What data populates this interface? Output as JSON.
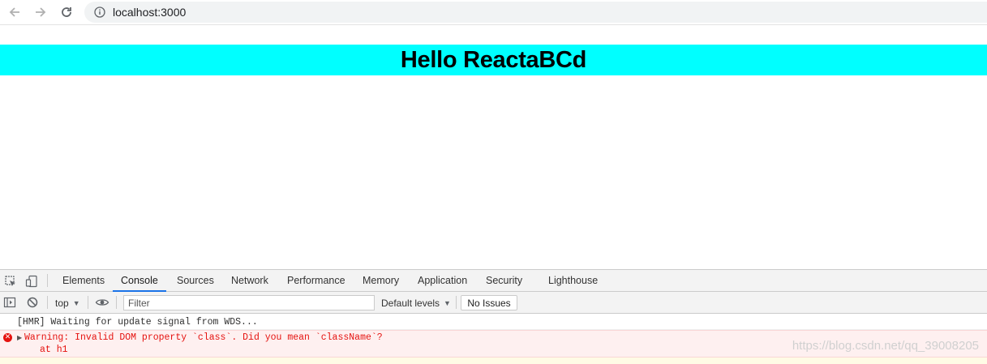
{
  "browser": {
    "url": "localhost:3000"
  },
  "page": {
    "heading": "Hello ReactaBCd",
    "heading_bg": "#00ffff"
  },
  "devtools": {
    "tabs": [
      {
        "label": "Elements"
      },
      {
        "label": "Console",
        "active": true
      },
      {
        "label": "Sources"
      },
      {
        "label": "Network"
      },
      {
        "label": "Performance"
      },
      {
        "label": "Memory"
      },
      {
        "label": "Application"
      },
      {
        "label": "Security"
      },
      {
        "label": "Lighthouse"
      }
    ],
    "toolbar": {
      "context": "top",
      "filter_placeholder": "Filter",
      "levels": "Default levels",
      "issues": "No Issues"
    },
    "console": {
      "info": "[HMR] Waiting for update signal from WDS...",
      "error_message": "Warning: Invalid DOM property `class`. Did you mean `className`?",
      "error_stack": "at h1",
      "error_color": "#e5120f"
    }
  },
  "watermark": "https://blog.csdn.net/qq_39008205"
}
